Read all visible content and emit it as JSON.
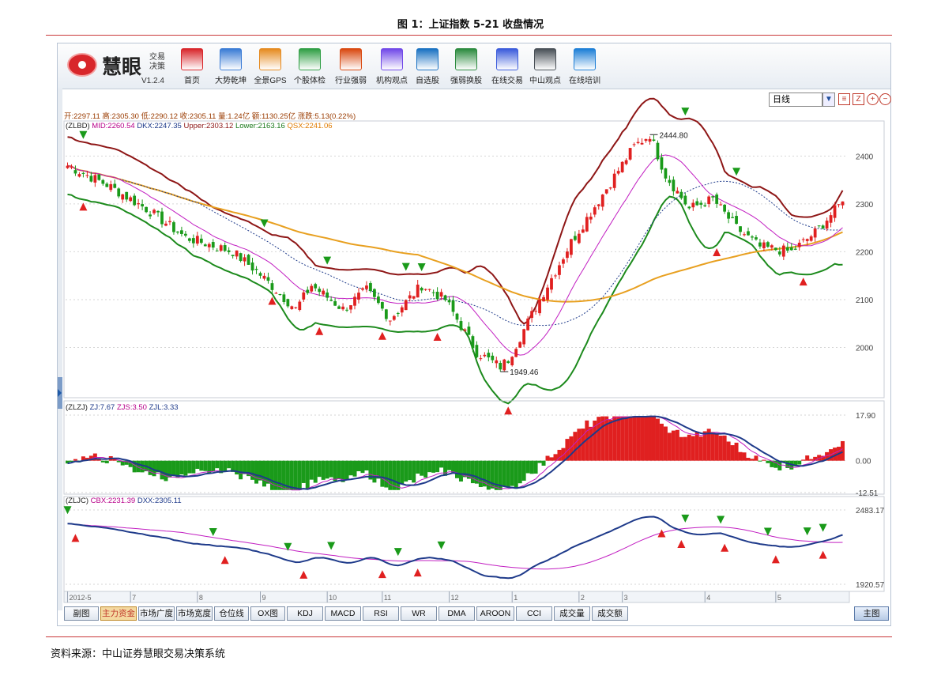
{
  "figure": {
    "title": "图 1：上证指数 5-21 收盘情况",
    "source": "资料来源：中山证券慧眼交易决策系统"
  },
  "app": {
    "name": "慧眼",
    "subtitle": "交易决策",
    "version": "V1.2.4",
    "toolbar": [
      {
        "label": "首页",
        "icon": "home-icon",
        "color": "#d8262b"
      },
      {
        "label": "大势乾坤",
        "icon": "magnifier-doc-icon",
        "color": "#3a7bd5"
      },
      {
        "label": "全景GPS",
        "icon": "grid-icon",
        "color": "#e58a1f"
      },
      {
        "label": "个股体检",
        "icon": "checkup-icon",
        "color": "#2f9e44"
      },
      {
        "label": "行业强弱",
        "icon": "bar-chart-icon",
        "color": "#d9480f"
      },
      {
        "label": "机构观点",
        "icon": "people-icon",
        "color": "#7048e8"
      },
      {
        "label": "自选股",
        "icon": "briefcase-icon",
        "color": "#1971c2"
      },
      {
        "label": "强弱换股",
        "icon": "swap-icon",
        "color": "#2b8a3e"
      },
      {
        "label": "在线交易",
        "icon": "cart-icon",
        "color": "#3b5bdb"
      },
      {
        "label": "中山观点",
        "icon": "document-icon",
        "color": "#495057"
      },
      {
        "label": "在线培训",
        "icon": "monitor-icon",
        "color": "#1c7ed6"
      }
    ],
    "period": "日线"
  },
  "info_line": "开:2297.11  高:2305.30  低:2290.12  收:2305.11  量:1.24亿  额:1130.25亿  涨跌:5.13(0.22%)",
  "legends": {
    "main": {
      "name": "(ZLBD)",
      "mid": "MID:2260.54",
      "dkx": "DKX:2247.35",
      "upper": "Upper:2303.12",
      "lower": "Lower:2163.16",
      "qsx": "QSX:2241.06"
    },
    "zj": {
      "name": "(ZLZJ)",
      "zj": "ZJ:7.67",
      "zjs": "ZJS:3.50",
      "zjl": "ZJL:3.33"
    },
    "jc": {
      "name": "(ZLJC)",
      "cbx": "CBX:2231.39",
      "dxx": "DXX:2305.11"
    }
  },
  "tabs": [
    "副图",
    "主力资金",
    "市场广度",
    "市场宽度",
    "仓位线",
    "OX图",
    "KDJ",
    "MACD",
    "RSI",
    "WR",
    "DMA",
    "AROON",
    "CCI",
    "成交量",
    "成交额"
  ],
  "main_tab": "主图",
  "active_tab": "主力资金",
  "chart_data": [
    {
      "type": "candlestick",
      "title": "(ZLBD)",
      "x_ticks": [
        "2012-5",
        "7",
        "8",
        "9",
        "10",
        "11",
        "12",
        "1",
        "2",
        "3",
        "4",
        "5"
      ],
      "ylim": [
        1900,
        2470
      ],
      "y_ticks": [
        2000,
        2100,
        2200,
        2300,
        2400
      ],
      "annotations": [
        {
          "label": "2444.80",
          "kind": "high"
        },
        {
          "label": "1949.46",
          "kind": "low"
        }
      ],
      "price_path": [
        [
          0,
          2380
        ],
        [
          10,
          2340
        ],
        [
          20,
          2290
        ],
        [
          30,
          2230
        ],
        [
          42,
          2200
        ],
        [
          48,
          2160
        ],
        [
          58,
          2080
        ],
        [
          62,
          2130
        ],
        [
          70,
          2080
        ],
        [
          76,
          2120
        ],
        [
          82,
          2060
        ],
        [
          90,
          2130
        ],
        [
          96,
          2100
        ],
        [
          104,
          1990
        ],
        [
          110,
          1960
        ],
        [
          112,
          1975
        ],
        [
          120,
          2100
        ],
        [
          128,
          2220
        ],
        [
          136,
          2320
        ],
        [
          144,
          2420
        ],
        [
          148,
          2444.8
        ],
        [
          152,
          2360
        ],
        [
          158,
          2290
        ],
        [
          164,
          2310
        ],
        [
          170,
          2250
        ],
        [
          176,
          2210
        ],
        [
          184,
          2200
        ],
        [
          190,
          2240
        ],
        [
          197,
          2305.11
        ]
      ],
      "n_bars": 198,
      "last_bar": {
        "open": 2297.11,
        "high": 2305.3,
        "low": 2290.12,
        "close": 2305.11
      },
      "indicators": {
        "MID": 2260.54,
        "DKX": 2247.35,
        "Upper": 2303.12,
        "Lower": 2163.16,
        "QSX": 2241.06
      },
      "signals_up": [
        4,
        52,
        64,
        80,
        94,
        112,
        165,
        187
      ],
      "signals_down": [
        4,
        50,
        66,
        86,
        90,
        157,
        170
      ]
    },
    {
      "type": "bar",
      "title": "(ZLZJ)",
      "ylim": [
        -12.51,
        17.9
      ],
      "y_ticks": [
        17.9,
        0.0,
        -12.51
      ],
      "last": {
        "ZJ": 7.67,
        "ZJS": 3.5,
        "ZJL": 3.33
      }
    },
    {
      "type": "line",
      "title": "(ZLJC)",
      "ylim": [
        1920.57,
        2483.17
      ],
      "y_ticks": [
        2483.17,
        1920.57
      ],
      "last": {
        "CBX": 2231.39,
        "DXX": 2305.11
      },
      "signals_up": [
        0,
        37,
        56,
        67,
        84,
        95,
        157,
        166,
        178,
        188,
        192
      ],
      "signals_down": [
        2,
        40,
        60,
        80,
        89,
        151,
        156,
        167,
        180,
        192
      ]
    }
  ],
  "colors": {
    "up": "#e02020",
    "down": "#1a9a1a",
    "upper_band": "#8e1616",
    "lower_band": "#1c8a1c",
    "mid": "#c21fc2",
    "dkx": "#1e3a8a",
    "qsx": "#e8a020",
    "grid": "#d6d6d6"
  }
}
